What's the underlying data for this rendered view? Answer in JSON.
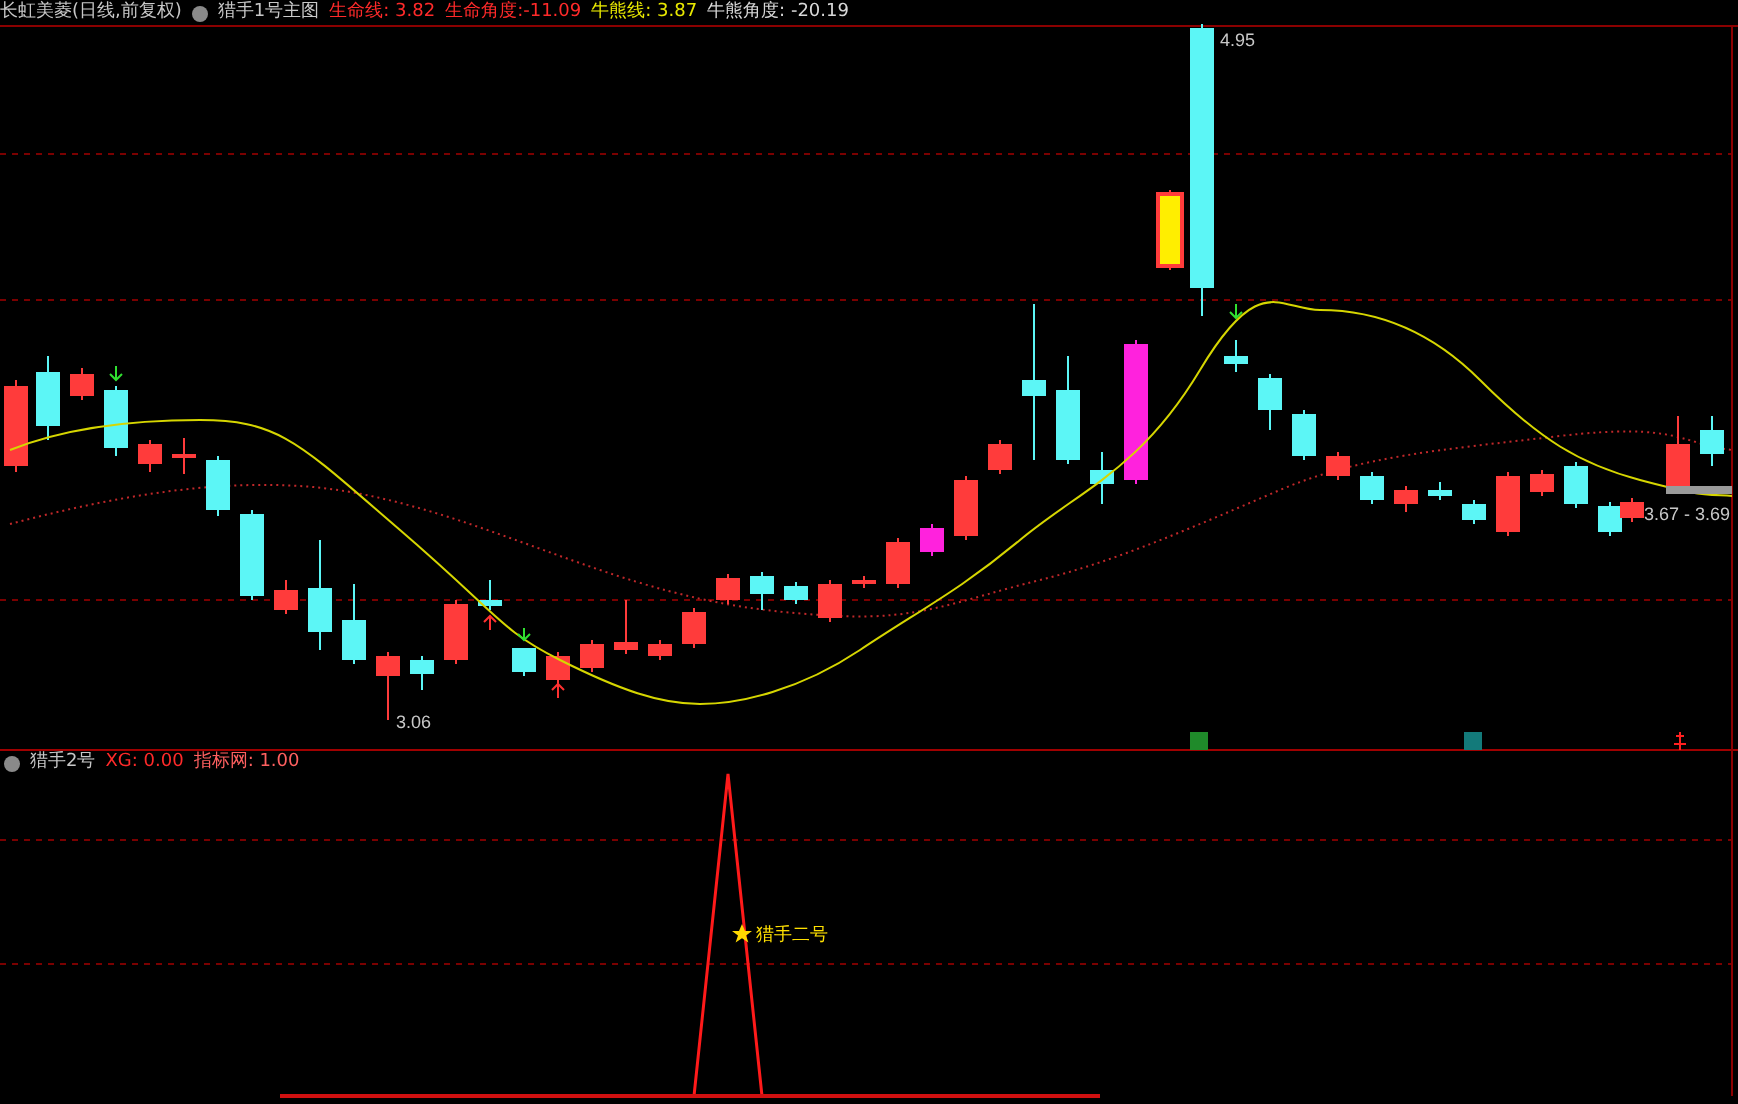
{
  "main_panel": {
    "title": "长虹美菱(日线,前复权)",
    "indicator": "猎手1号主图",
    "readouts": [
      {
        "text": "生命线: 3.82",
        "color": "#ff2a2a"
      },
      {
        "text": "生命角度:-11.09",
        "color": "#ff2a2a"
      },
      {
        "text": "牛熊线: 3.87",
        "color": "#e8e800"
      },
      {
        "text": "牛熊角度: -20.19",
        "color": "#d8d8d8"
      }
    ],
    "price_labels": [
      {
        "text": "4.95",
        "kind": "high"
      },
      {
        "text": "3.06",
        "kind": "low"
      },
      {
        "text": "3.67 - 3.69",
        "kind": "current"
      }
    ]
  },
  "sub_panel": {
    "indicator": "猎手2号",
    "readouts": [
      {
        "text": "XG: 0.00",
        "color": "#ff2a2a"
      },
      {
        "text": "指标网: 1.00",
        "color": "#ff6060"
      }
    ],
    "signal_label": "猎手二号"
  }
}
